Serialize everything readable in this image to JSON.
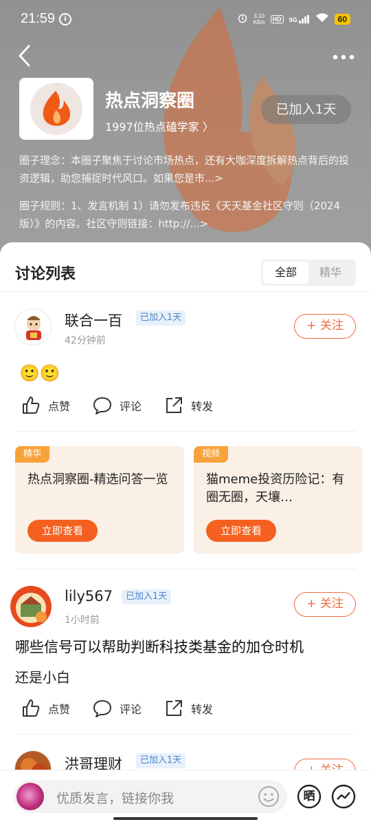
{
  "status_bar": {
    "time": "21:59",
    "app_glyph": "ℹ",
    "net_speed_top": "3.10",
    "net_speed_bottom": "KB/s",
    "hd": "HD",
    "signal": "5G",
    "battery": "60"
  },
  "circle": {
    "title": "热点洞察圈",
    "members": "1997位热点磕学家 〉",
    "joined": "已加入1天",
    "intro": "圈子理念：本圈子聚焦于讨论市场热点，还有大咖深度拆解热点背后的投资逻辑，助您捕捉时代风口。如果您是市...>",
    "rules": "圈子规则：1、发言机制 1）请勿发布违反《天天基金社区守则（2024版）》的内容。社区守则链接：http://...>"
  },
  "list": {
    "title": "讨论列表",
    "tabs": [
      "全部",
      "精华"
    ]
  },
  "posts": [
    {
      "user": "联合一百",
      "tag": "已加入1天",
      "time": "42分钟前",
      "follow": "+ 关注",
      "body": "🙂🙂",
      "actions": {
        "like": "点赞",
        "comment": "评论",
        "share": "转发"
      }
    },
    {
      "user": "lily567",
      "tag": "已加入1天",
      "time": "1小时前",
      "follow": "+ 关注",
      "title": "哪些信号可以帮助判断科技类基金的加仓时机",
      "body": "还是小白",
      "actions": {
        "like": "点赞",
        "comment": "评论",
        "share": "转发"
      }
    },
    {
      "user": "洪哥理财",
      "tag": "已加入1天",
      "follow": "+ 关注"
    }
  ],
  "cards": [
    {
      "badge": "精华",
      "title": "热点洞察圈-精选问答一览",
      "button": "立即查看"
    },
    {
      "badge": "视频",
      "title": "猫meme投资历险记：有圈无圈，天壤…",
      "button": "立即查看"
    }
  ],
  "composer": {
    "placeholder": "优质发言，链接你我",
    "sun_label": "晒"
  },
  "colors": {
    "accent": "#f4601f",
    "tag_bg": "#e8f1fb",
    "tag_text": "#4b86c7",
    "card_bg": "#fbf0e6",
    "badge": "#f8a23c"
  }
}
